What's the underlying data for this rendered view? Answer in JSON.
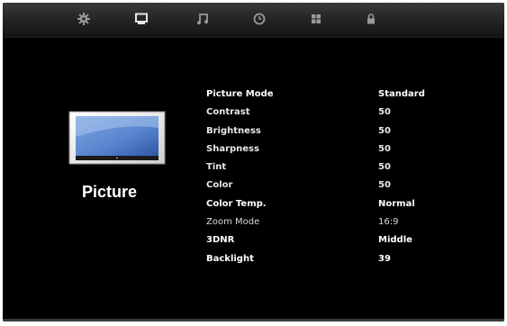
{
  "tabs": [
    {
      "name": "settings",
      "icon": "gear-icon",
      "active": false
    },
    {
      "name": "picture",
      "icon": "monitor-icon",
      "active": true
    },
    {
      "name": "sound",
      "icon": "music-note-icon",
      "active": false
    },
    {
      "name": "time",
      "icon": "clock-icon",
      "active": false
    },
    {
      "name": "setup",
      "icon": "grid-icon",
      "active": false
    },
    {
      "name": "lock",
      "icon": "lock-icon",
      "active": false
    }
  ],
  "section": {
    "title": "Picture",
    "icon": "tv-screen-icon"
  },
  "menu": {
    "items": [
      {
        "label": "Picture Mode",
        "value": "Standard"
      },
      {
        "label": "Contrast",
        "value": "50"
      },
      {
        "label": "Brightness",
        "value": "50"
      },
      {
        "label": "Sharpness",
        "value": "50"
      },
      {
        "label": "Tint",
        "value": "50"
      },
      {
        "label": "Color",
        "value": "50"
      },
      {
        "label": "Color Temp.",
        "value": "Normal"
      },
      {
        "label": "Zoom Mode",
        "value": "16:9"
      },
      {
        "label": "3DNR",
        "value": "Middle"
      },
      {
        "label": "Backlight",
        "value": "39"
      }
    ]
  },
  "colors": {
    "background": "#000000",
    "text": "#ffffff",
    "topbar": "#2a2a2a",
    "icon_inactive": "#9a9a9a"
  }
}
